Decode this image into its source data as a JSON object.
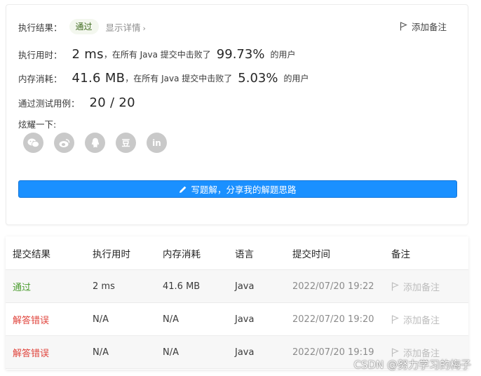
{
  "result": {
    "status_label": "执行结果：",
    "status_badge": "通过",
    "details_link": "显示详情",
    "add_note": "添加备注",
    "runtime_label": "执行用时：",
    "runtime_value": "2 ms",
    "runtime_mid": "，在所有 Java 提交中击败了",
    "runtime_pct": "99.73%",
    "runtime_tail": "的用户",
    "memory_label": "内存消耗：",
    "memory_value": "41.6 MB",
    "memory_mid": "，在所有 Java 提交中击败了",
    "memory_pct": "5.03%",
    "memory_tail": "的用户",
    "tests_label": "通过测试用例：",
    "tests_value": "20 / 20",
    "share_label": "炫耀一下:",
    "social_icons": [
      "wechat-icon",
      "weibo-icon",
      "qq-icon",
      "douban-icon",
      "linkedin-icon"
    ],
    "douban_glyph": "豆",
    "linkedin_glyph": "in",
    "write_button": "写题解，分享我的解题思路"
  },
  "table": {
    "headers": [
      "提交结果",
      "执行用时",
      "内存消耗",
      "语言",
      "提交时间",
      "备注"
    ],
    "rows": [
      {
        "result": "通过",
        "time": "2 ms",
        "memory": "41.6 MB",
        "lang": "Java",
        "submitted": "2022/07/20 19:22",
        "note": "添加备注"
      },
      {
        "result": "解答错误",
        "time": "N/A",
        "memory": "N/A",
        "lang": "Java",
        "submitted": "2022/07/20 19:20",
        "note": "添加备注"
      },
      {
        "result": "解答错误",
        "time": "N/A",
        "memory": "N/A",
        "lang": "Java",
        "submitted": "2022/07/20 19:19",
        "note": "添加备注"
      }
    ]
  },
  "watermark": "CSDN @努力学习的梅子",
  "colors": {
    "accent": "#1a90ff",
    "pass": "#4a9c2d",
    "error": "#e0443c",
    "muted": "#8c8c8c"
  }
}
